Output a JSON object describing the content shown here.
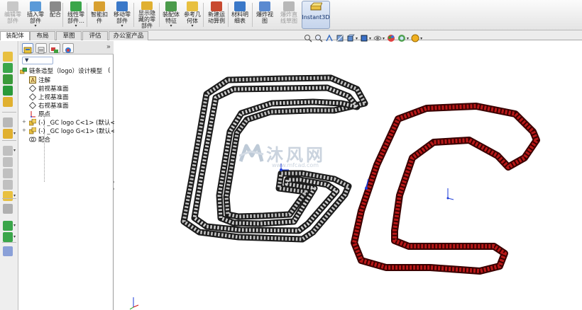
{
  "ribbon": {
    "buttons": [
      {
        "id": "edit-component",
        "label": "编辑零\n部件",
        "disabled": true,
        "icon": "edit-component-icon",
        "arrow": false
      },
      {
        "id": "insert-component",
        "label": "插入零\n部件",
        "disabled": false,
        "icon": "insert-component-icon",
        "arrow": true
      },
      {
        "id": "mate",
        "label": "配合",
        "disabled": false,
        "icon": "mate-icon",
        "arrow": false
      },
      {
        "id": "linear-pattern",
        "label": "线性零\n部件…",
        "disabled": false,
        "icon": "linear-pattern-icon",
        "arrow": true
      },
      {
        "id": "smart-fasteners",
        "label": "智能扣\n件",
        "disabled": false,
        "icon": "smart-fasteners-icon",
        "arrow": false
      },
      {
        "id": "move-component",
        "label": "移动零\n部件",
        "disabled": false,
        "icon": "move-component-icon",
        "arrow": true
      },
      {
        "id": "show-hidden",
        "label": "显示隐\n藏的零\n部件",
        "disabled": false,
        "icon": "show-hidden-icon",
        "arrow": false
      },
      {
        "id": "assembly-features",
        "label": "装配体\n特征",
        "disabled": false,
        "icon": "assembly-features-icon",
        "arrow": true
      },
      {
        "id": "reference-geometry",
        "label": "参考几\n何体",
        "disabled": false,
        "icon": "reference-geometry-icon",
        "arrow": true
      },
      {
        "id": "new-motion-study",
        "label": "新建运\n动算例",
        "disabled": false,
        "icon": "motion-study-icon",
        "arrow": false
      },
      {
        "id": "bom",
        "label": "材料明\n细表",
        "disabled": false,
        "icon": "bom-icon",
        "arrow": false
      },
      {
        "id": "exploded-view",
        "label": "爆炸视\n图",
        "disabled": false,
        "icon": "exploded-view-icon",
        "arrow": false
      },
      {
        "id": "explode-line-sketch",
        "label": "爆炸直\n线草图",
        "disabled": true,
        "icon": "explode-line-icon",
        "arrow": false
      }
    ],
    "instant3d": "Instant3D"
  },
  "tabs": [
    "装配体",
    "布局",
    "草图",
    "评估",
    "办公室产品"
  ],
  "active_tab": "装配体",
  "feature_tree": {
    "filter_symbol": "▼",
    "root": "链条造型（logo）设计模型",
    "root_suffix": "(",
    "items": [
      {
        "label": "注解",
        "icon": "annotations-icon"
      },
      {
        "label": "前视基准面",
        "icon": "front-plane-icon"
      },
      {
        "label": "上视基准面",
        "icon": "top-plane-icon"
      },
      {
        "label": "右视基准面",
        "icon": "right-plane-icon"
      },
      {
        "label": "原点",
        "icon": "origin-icon"
      },
      {
        "label": "(-) _GC logo C<1> (默认<",
        "icon": "component-icon",
        "expander": "+"
      },
      {
        "label": "(-) _GC logo G<1> (默认<",
        "icon": "component-icon",
        "expander": "+"
      },
      {
        "label": "配合",
        "icon": "mates-folder-icon"
      }
    ]
  },
  "graphics": {
    "watermark_text": "沐风网",
    "watermark_url": "www.mfcad.com",
    "chain_colors": {
      "g": "#5e5e5e",
      "c": "#9a1212"
    }
  }
}
